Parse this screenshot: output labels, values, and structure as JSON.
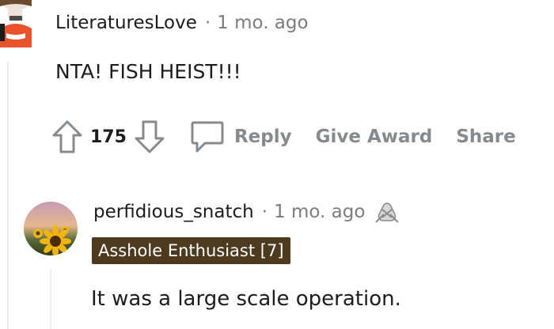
{
  "comment_1": {
    "author": "LiteraturesLove",
    "separator": "·",
    "timestamp": "1 mo. ago",
    "body": "NTA! FISH HEIST!!!",
    "vote_count": "175",
    "actions": {
      "reply": "Reply",
      "give_award": "Give Award",
      "share": "Share"
    }
  },
  "comment_2": {
    "author": "perfidious_snatch",
    "separator": "·",
    "timestamp": "1 mo. ago",
    "flair": "Asshole Enthusiast [7]",
    "body": "It was a large scale operation."
  },
  "colors": {
    "text": "#1c1c1c",
    "meta": "#7c7c7c",
    "action": "#878a8c",
    "flair_bg": "#4d3a1f",
    "threadline": "#eceeef"
  },
  "icons": {
    "upvote": "arrow-up-icon",
    "downvote": "arrow-down-icon",
    "reply": "speech-bubble-icon",
    "award": "gift-award-icon"
  }
}
